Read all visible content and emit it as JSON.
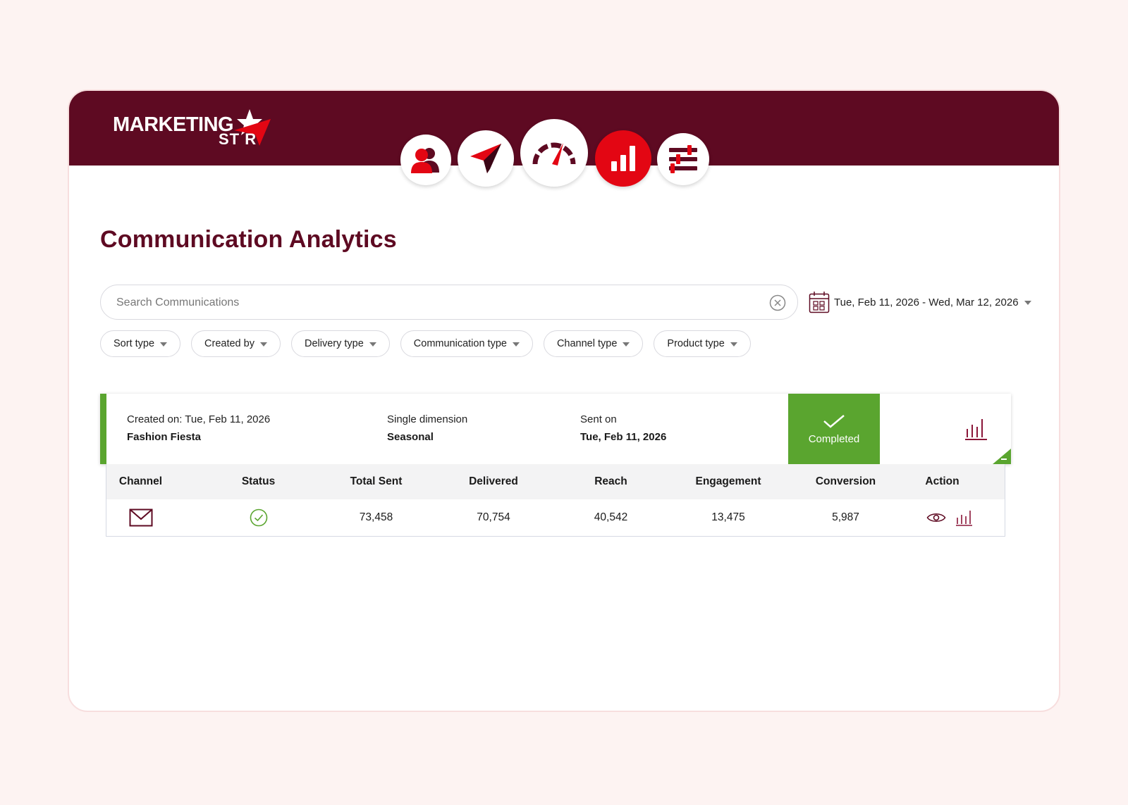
{
  "header": {
    "logo_word1": "MARKETING",
    "logo_word2": "ST R",
    "nav": [
      {
        "icon": "users-icon",
        "active": false
      },
      {
        "icon": "paper-plane-icon",
        "active": false
      },
      {
        "icon": "gauge-icon",
        "active": false
      },
      {
        "icon": "bar-chart-icon",
        "active": true
      },
      {
        "icon": "sliders-icon",
        "active": false
      }
    ]
  },
  "page": {
    "title": "Communication Analytics"
  },
  "search": {
    "placeholder": "Search Communications",
    "value": ""
  },
  "date_range": {
    "label": "Tue, Feb 11, 2026 - Wed, Mar 12, 2026"
  },
  "filters": [
    {
      "label": "Sort type"
    },
    {
      "label": "Created by"
    },
    {
      "label": "Delivery type"
    },
    {
      "label": "Communication type"
    },
    {
      "label": "Channel type"
    },
    {
      "label": "Product type"
    }
  ],
  "communication": {
    "created_label": "Created on: Tue, Feb 11, 2026",
    "name": "Fashion Fiesta",
    "dimension_label": "Single dimension",
    "dimension_value": "Seasonal",
    "sent_label": "Sent on",
    "sent_value": "Tue, Feb 11, 2026",
    "status": "Completed",
    "status_color": "#5aa52f"
  },
  "table": {
    "headers": [
      "Channel",
      "Status",
      "Total Sent",
      "Delivered",
      "Reach",
      "Engagement",
      "Conversion",
      "Action"
    ],
    "rows": [
      {
        "channel_icon": "email-icon",
        "status_icon": "check-circle-icon",
        "total_sent": "73,458",
        "delivered": "70,754",
        "reach": "40,542",
        "engagement": "13,475",
        "conversion": "5,987"
      }
    ]
  },
  "colors": {
    "brand_dark": "#5e0a22",
    "brand_red": "#e30613",
    "success": "#5aa52f"
  }
}
